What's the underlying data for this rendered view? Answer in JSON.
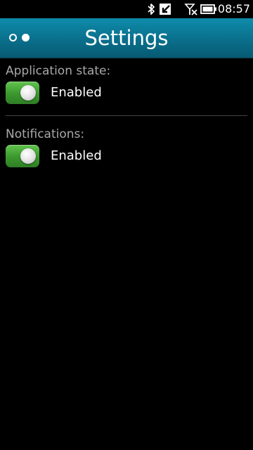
{
  "status_bar": {
    "time": "08:57",
    "icons": [
      "bluetooth-icon",
      "usb-icon",
      "no-signal-icon",
      "battery-icon"
    ]
  },
  "header": {
    "title": "Settings",
    "page_indicator": {
      "total": 2,
      "current": 2
    }
  },
  "settings": [
    {
      "label": "Application state:",
      "state": "Enabled",
      "on": true
    },
    {
      "label": "Notifications:",
      "state": "Enabled",
      "on": true
    }
  ],
  "colors": {
    "header": "#0a7a99",
    "toggle_on": "#3c9b2f",
    "label": "#a9a9a9",
    "background": "#000000"
  }
}
